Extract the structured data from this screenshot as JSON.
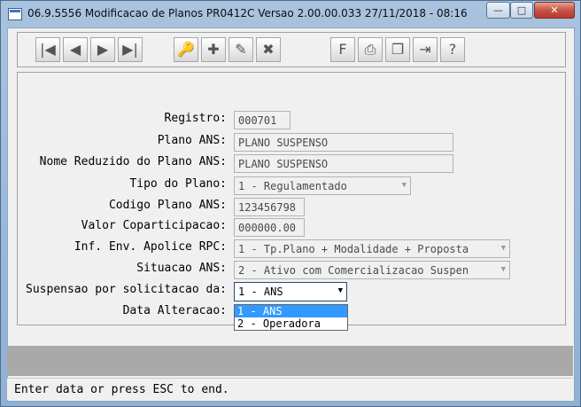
{
  "window": {
    "title": "06.9.5556  Modificacao de Planos PR0412C Versao 2.00.00.033 27/11/2018 - 08:16",
    "controls": {
      "minimize": "—",
      "maximize": "□",
      "close": "✕"
    }
  },
  "toolbar": {
    "buttons": [
      {
        "name": "first-record",
        "glyph": "|◀"
      },
      {
        "name": "previous-record",
        "glyph": "◀"
      },
      {
        "name": "next-record",
        "glyph": "▶"
      },
      {
        "name": "last-record",
        "glyph": "▶|"
      },
      {
        "name": "search",
        "glyph": "🔑"
      },
      {
        "name": "add",
        "glyph": "✚"
      },
      {
        "name": "edit",
        "glyph": "✎"
      },
      {
        "name": "delete",
        "glyph": "✖"
      },
      {
        "name": "filter",
        "glyph": "F"
      },
      {
        "name": "print",
        "glyph": "⎙"
      },
      {
        "name": "copy",
        "glyph": "❐"
      },
      {
        "name": "exit",
        "glyph": "⇥"
      },
      {
        "name": "help",
        "glyph": "?"
      }
    ]
  },
  "form": {
    "registro": {
      "label": "Registro:",
      "value": "000701"
    },
    "plano_ans": {
      "label": "Plano ANS:",
      "value": "PLANO SUSPENSO"
    },
    "nome_reduzido": {
      "label": "Nome Reduzido do Plano ANS:",
      "value": "PLANO SUSPENSO"
    },
    "tipo_plano": {
      "label": "Tipo do Plano:",
      "value": "1 - Regulamentado"
    },
    "codigo_plano": {
      "label": "Codigo Plano ANS:",
      "value": "123456798"
    },
    "valor_copart": {
      "label": "Valor Coparticipacao:",
      "value": "000000.00"
    },
    "inf_env": {
      "label": "Inf. Env. Apolice RPC:",
      "value": "1 - Tp.Plano + Modalidade + Proposta"
    },
    "situacao": {
      "label": "Situacao ANS:",
      "value": "2 - Ativo com Comercializacao Suspen"
    },
    "suspensao": {
      "label": "Suspensao por solicitacao da:",
      "value": "1 - ANS",
      "options": [
        "1 - ANS",
        "2 - Operadora"
      ]
    },
    "data_alteracao": {
      "label": "Data Alteracao:"
    }
  },
  "status": {
    "text": "Enter data or press ESC to end."
  }
}
